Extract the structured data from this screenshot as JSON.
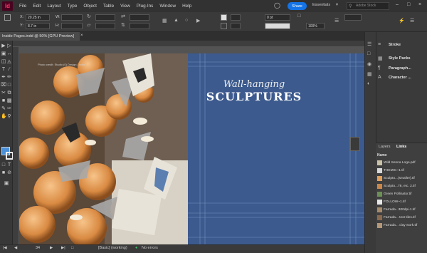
{
  "app": {
    "logo": "Id"
  },
  "menu": [
    "File",
    "Edit",
    "Layout",
    "Type",
    "Object",
    "Table",
    "View",
    "Plug-Ins",
    "Window",
    "Help"
  ],
  "share_label": "Share",
  "workspace_label": "Essentials",
  "search_placeholder": "Adobe Stock",
  "control": {
    "x_label": "X:",
    "x_value": "20.25 in",
    "y_label": "Y:",
    "y_value": "8.7 in",
    "w_label": "W:",
    "h_label": "H:",
    "stroke_value": "0 pt",
    "zoom_value": "100%"
  },
  "document_tab": "Inside Pages.indd @ 50% [GPU Preview]",
  "canvas": {
    "photo_caption": "Photo credit: Studio (0) Design | Indie",
    "headline_line1": "Wall-hanging",
    "headline_line2": "SCULPTURES"
  },
  "status": {
    "page_number": "34",
    "preflight_profile": "[Basic] (working)",
    "errors": "No errors"
  },
  "dock": [
    {
      "label": "Stroke",
      "icon": "stroke-icon"
    },
    {
      "label": "Style Packs",
      "icon": "style-packs-icon"
    },
    {
      "label": "Paragraph...",
      "icon": "paragraph-icon"
    },
    {
      "label": "Character ...",
      "icon": "character-icon"
    }
  ],
  "links_panel": {
    "tabs": [
      "Layers",
      "Links"
    ],
    "column_header": "Name",
    "items": [
      "Wild Senna Logo.pdf",
      "THEMIC~1.tif",
      "Sculpto...(smaller).tif",
      "Sculpto...78, etc. 2.tif",
      "Green Pollinator.tif",
      "FOLLOW~1.tif",
      "Farrada...300dpi-1.tif",
      "Farrada... text tiles.tif",
      "Farrada... clay work.tif"
    ]
  },
  "colors": {
    "accent": "#1473e6",
    "page_blue": "#3c5a8e",
    "logo_bg": "#49021f"
  }
}
